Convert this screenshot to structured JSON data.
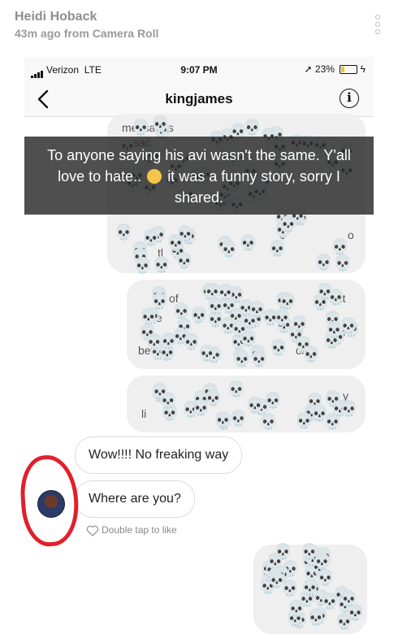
{
  "story": {
    "user": "Heidi Hoback",
    "subtitle": "43m ago from Camera Roll"
  },
  "status_bar": {
    "carrier": "Verizon",
    "network": "LTE",
    "time": "9:07 PM",
    "battery": "23%",
    "battery_level": 0.23,
    "battery_color": "#f3c614"
  },
  "nav": {
    "title": "kingjames",
    "back_icon": "chevron-left-icon",
    "info_icon": "info-icon",
    "info_glyph": "i"
  },
  "caption": {
    "line1": "To anyone saying his avi wasn't the same. Y'all",
    "line2a": "love to hate..",
    "line2b": "it was a funny story, sorry I",
    "line3": "shared.",
    "emoji_icon": "rolling-eyes-emoji-icon"
  },
  "obscured_fragments": {
    "f1": "messages",
    "f2": "sac",
    "f3": "y",
    "f4": "&",
    "f5": "o",
    "f6": "o",
    "f7": "tl",
    "f8": "of",
    "f9": "but",
    "f10": "e",
    "f11": "s",
    "f12": "bef",
    "f13": "e s",
    "f14": "ck",
    "f15": "y",
    "f16": "li"
  },
  "messages": {
    "outgoing1": "Wow!!!! No freaking way",
    "outgoing2": "Where are you?",
    "double_tap": "Double tap to like"
  },
  "colors": {
    "red_circle": "#e0202b",
    "bubble_gray": "#efefef"
  },
  "sticker": {
    "glyph": "💀",
    "name": "skull-sticker"
  }
}
